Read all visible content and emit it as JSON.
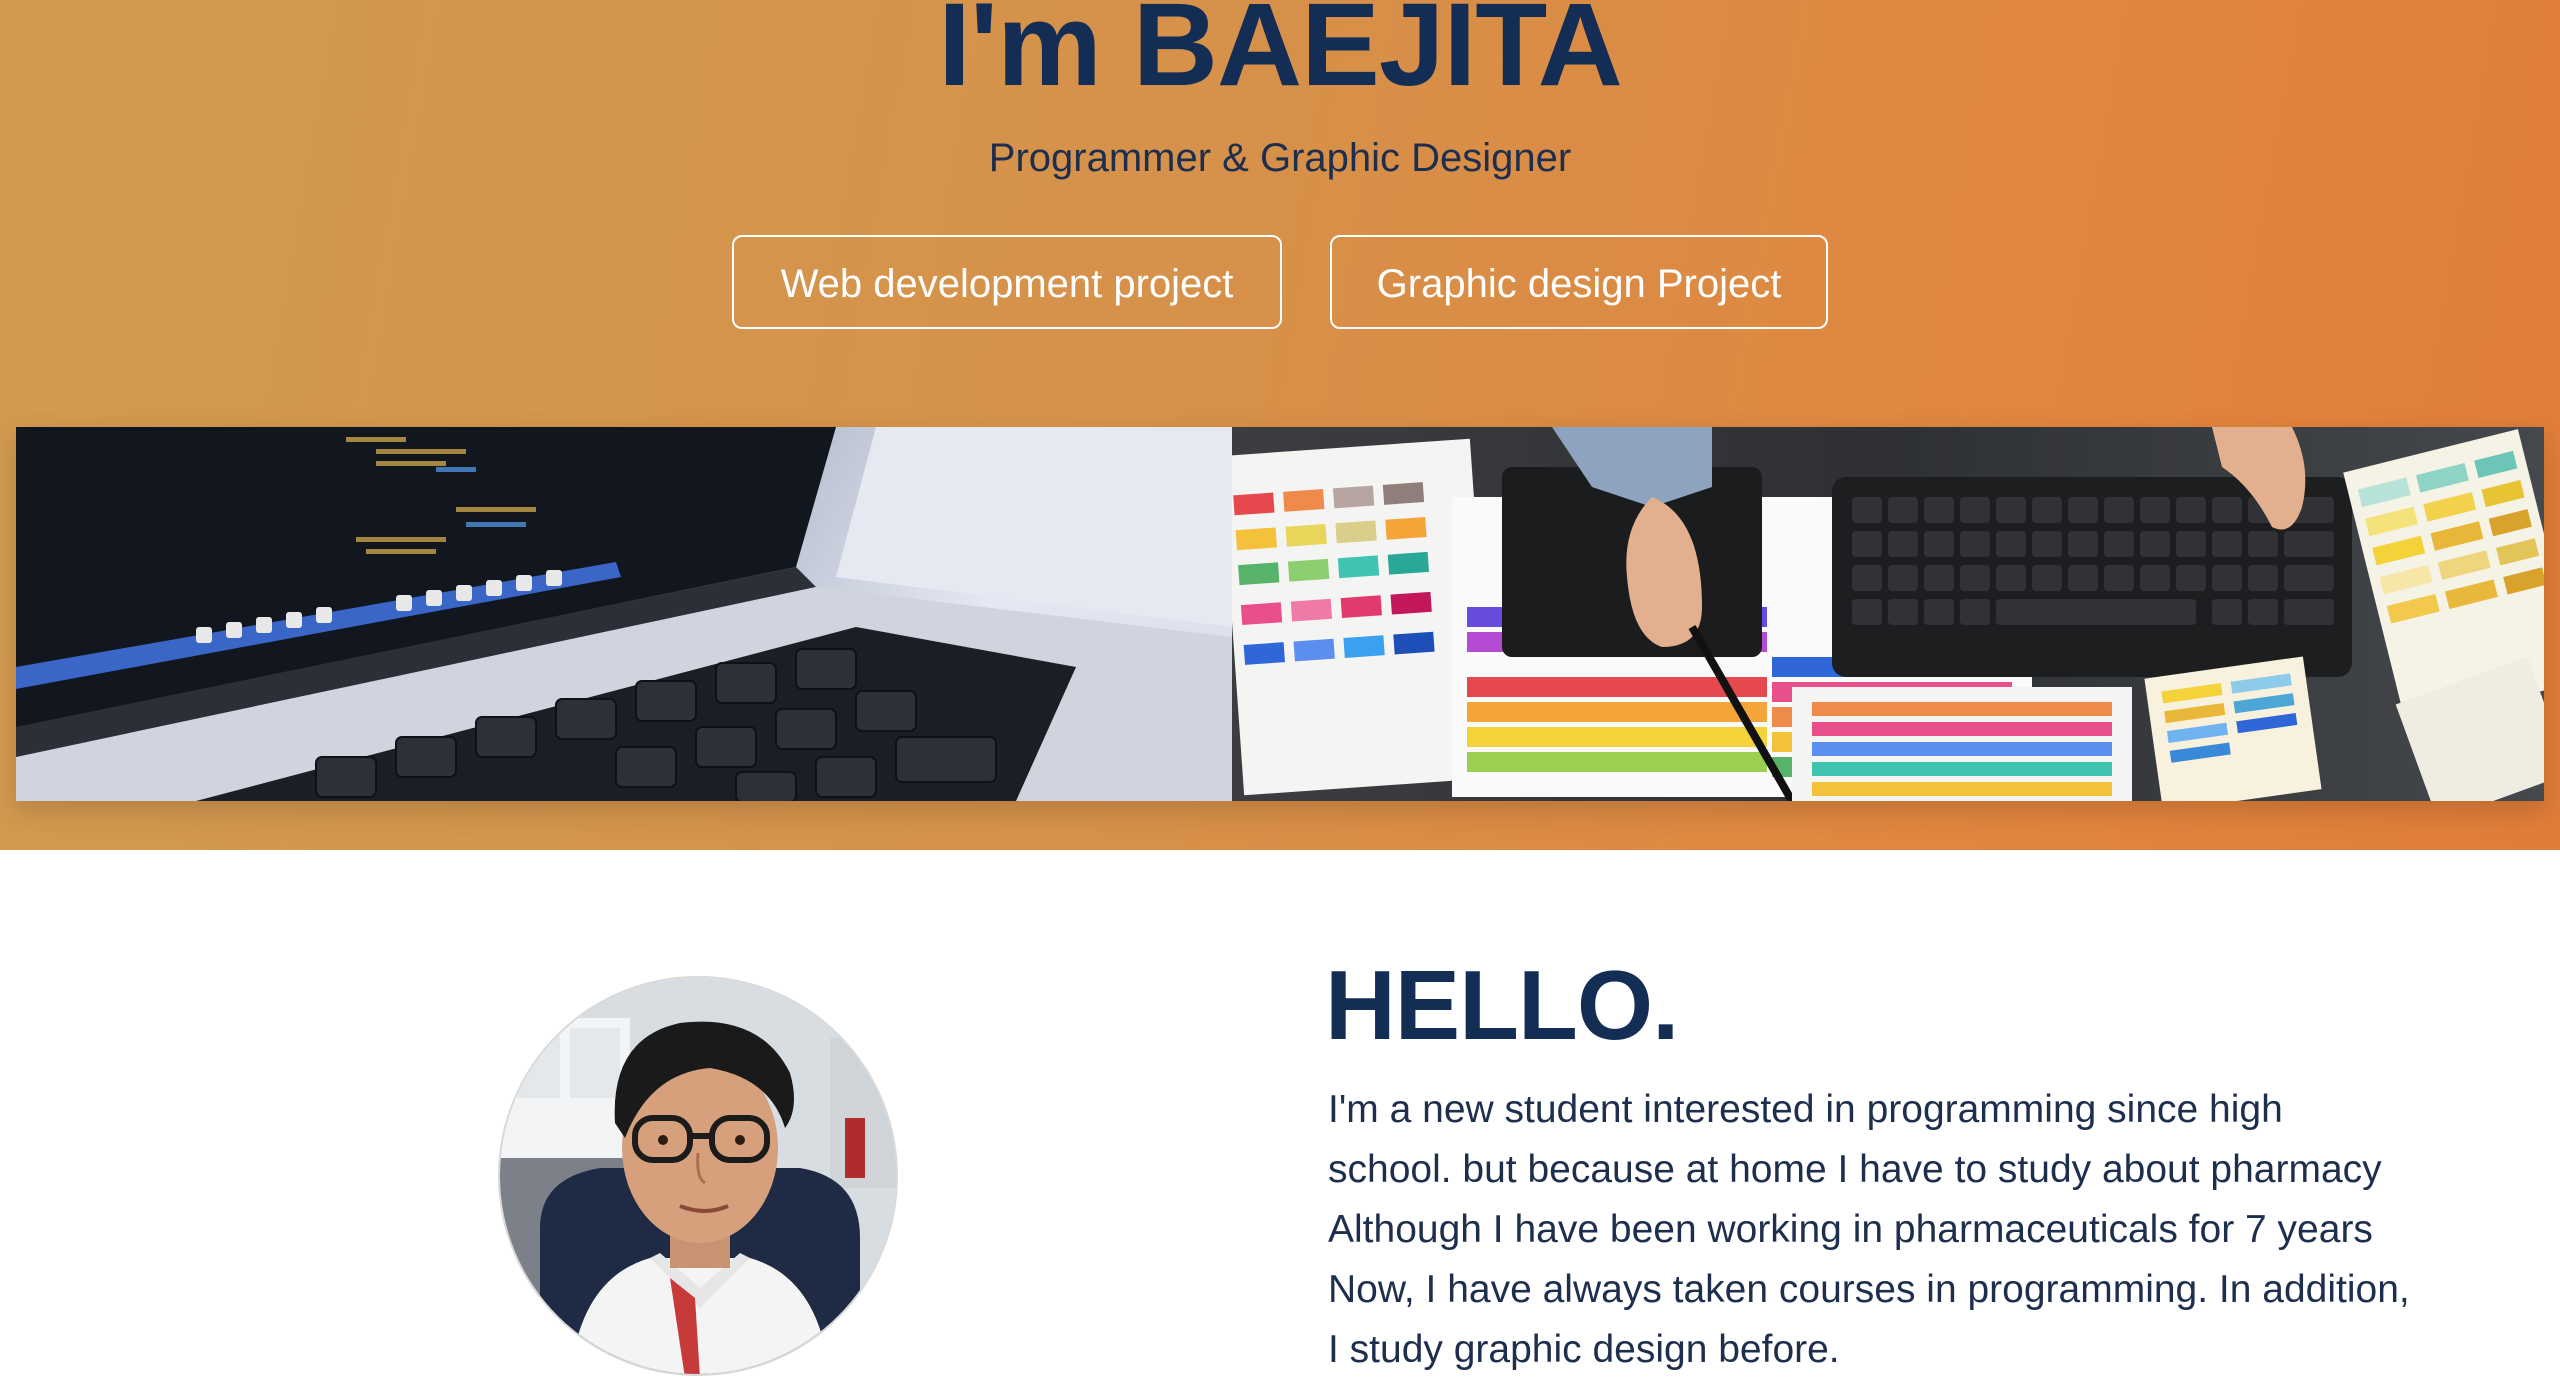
{
  "hero": {
    "title": "I'm BAEJITA",
    "subtitle": "Programmer & Graphic Designer",
    "buttons": [
      {
        "label": "Web development project"
      },
      {
        "label": "Graphic design Project"
      }
    ],
    "gradient_colors": [
      "#d19a50",
      "#e07c39"
    ]
  },
  "banner": {
    "left_image": "laptop-keyboard-code-photo",
    "right_image": "designer-keyboard-color-swatches-photo"
  },
  "about": {
    "heading": "HELLO.",
    "avatar": "profile-photo",
    "bio_lines": [
      "I'm a new student interested in programming since high",
      "school. but because at home I have to study about pharmacy",
      "Although I have been working in pharmaceuticals for 7 years",
      "Now, I have always taken courses in programming. In addition,",
      "I study graphic design before."
    ]
  },
  "colors": {
    "heading": "#142d55",
    "text": "#1e2f4e",
    "button_border": "#ffffff"
  }
}
